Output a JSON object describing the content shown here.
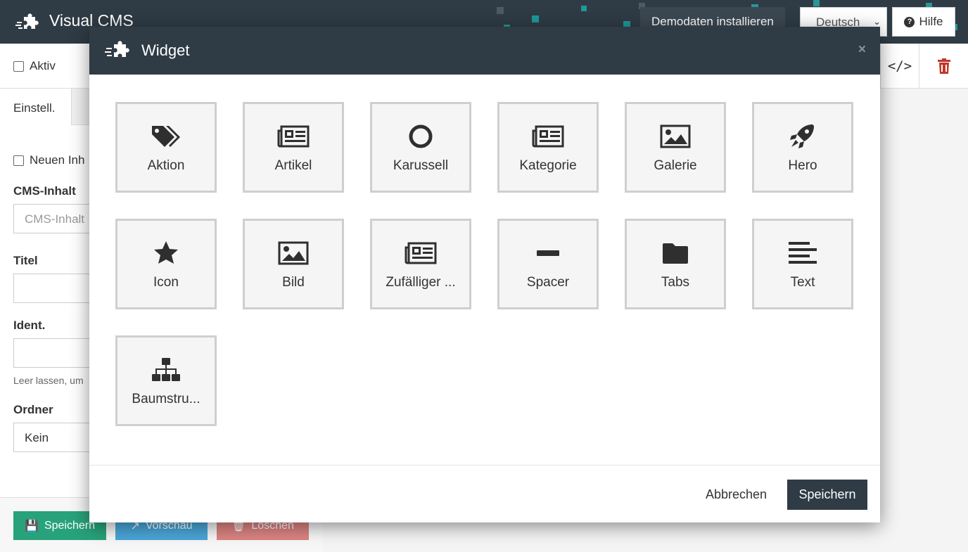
{
  "topbar": {
    "app_title": "Visual CMS",
    "demo_button": "Demodaten installieren",
    "language": "Deutsch",
    "help_button": "Hilfe"
  },
  "page": {
    "aktiv_label": "Aktiv",
    "code_button": "</>",
    "tab_einstell": "Einstell.",
    "neuen_label": "Neuen Inh",
    "cms_label": "CMS-Inhalt",
    "cms_placeholder": "CMS-Inhalt",
    "titel_label": "Titel",
    "ident_label": "Ident.",
    "hint": "Leer lassen, um",
    "ordner_label": "Ordner",
    "ordner_value": "Kein",
    "save_button": "Speichern",
    "preview_button": "Vorschau",
    "delete_button": "Löschen"
  },
  "modal": {
    "title": "Widget",
    "close": "×",
    "cancel": "Abbrechen",
    "save": "Speichern",
    "widgets": [
      {
        "label": "Aktion",
        "icon": "tags-icon"
      },
      {
        "label": "Artikel",
        "icon": "newspaper-icon"
      },
      {
        "label": "Karussell",
        "icon": "circle-icon"
      },
      {
        "label": "Kategorie",
        "icon": "newspaper-icon"
      },
      {
        "label": "Galerie",
        "icon": "image-icon"
      },
      {
        "label": "Hero",
        "icon": "rocket-icon"
      },
      {
        "label": "Icon",
        "icon": "star-icon"
      },
      {
        "label": "Bild",
        "icon": "image-icon"
      },
      {
        "label": "Zufälliger ...",
        "icon": "newspaper-icon"
      },
      {
        "label": "Spacer",
        "icon": "minus-icon"
      },
      {
        "label": "Tabs",
        "icon": "folder-icon"
      },
      {
        "label": "Text",
        "icon": "align-left-icon"
      },
      {
        "label": "Baumstru...",
        "icon": "sitemap-icon"
      }
    ]
  },
  "colors": {
    "dark": "#2f3b45",
    "save_green": "#28a27a",
    "preview_blue": "#4aa6d8",
    "delete_red": "#dc8482",
    "trash_red": "#c0392b"
  }
}
